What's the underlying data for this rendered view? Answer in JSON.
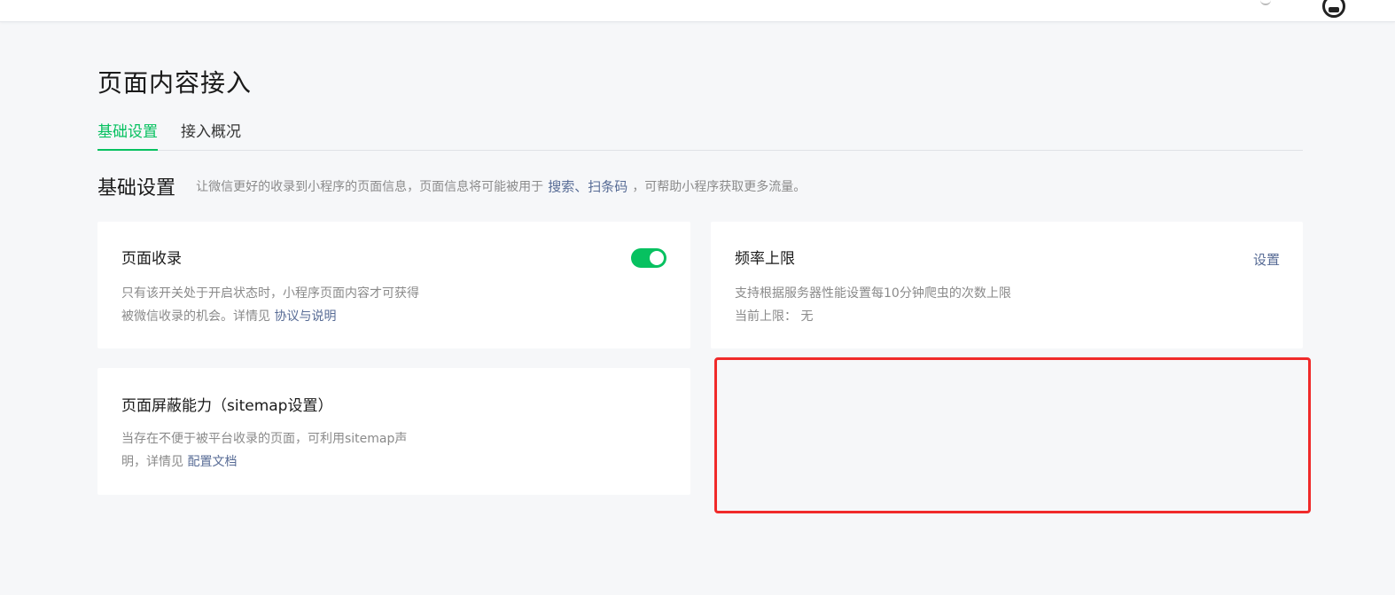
{
  "page": {
    "title": "页面内容接入"
  },
  "tabs": [
    {
      "label": "基础设置",
      "active": true
    },
    {
      "label": "接入概况",
      "active": false
    }
  ],
  "section": {
    "title": "基础设置",
    "desc_prefix": "让微信更好的收录到小程序的页面信息，页面信息将可能被用于",
    "link_label": "搜索、扫条码",
    "desc_suffix": "，可帮助小程序获取更多流量。"
  },
  "cards": {
    "page_indexing": {
      "title": "页面收录",
      "desc_line1": "只有该开关处于开启状态时，小程序页面内容才可获得",
      "desc_line2_prefix": "被微信收录的机会。详情见",
      "desc_link": "协议与说明",
      "toggle_on": true
    },
    "rate_limit": {
      "title": "频率上限",
      "action_label": "设置",
      "desc_line1": "支持根据服务器性能设置每10分钟爬虫的次数上限",
      "current_label": "当前上限：",
      "current_value": "无"
    },
    "sitemap": {
      "title": "页面屏蔽能力（sitemap设置）",
      "desc_line1": "当存在不便于被平台收录的页面，可利用sitemap声",
      "desc_line2_prefix": "明，详情见",
      "desc_link": "配置文档"
    }
  },
  "colors": {
    "accent": "#07c160",
    "link": "#576b95",
    "highlight": "#f02a2a",
    "background": "#f6f7f9"
  },
  "icons": {
    "topbar_user": "user-avatar-icon",
    "topbar_misc": "notification-icon"
  }
}
